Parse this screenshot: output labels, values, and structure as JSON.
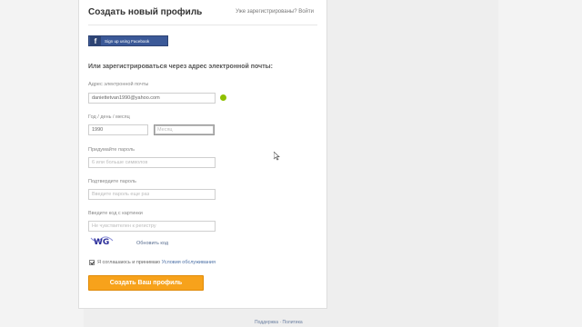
{
  "header": {
    "title": "Создать новый профиль",
    "login_link": "Уже зарегистрированы? Войти"
  },
  "facebook": {
    "label": "Sign up using Facebook",
    "icon": "facebook-f-icon"
  },
  "form": {
    "section_title": "Или зарегистрироваться через адрес электронной почты:",
    "email": {
      "label": "Адрес электронной почты",
      "value": "daniettetvan1990@yahoo.com",
      "status_icon": "check-ok-icon"
    },
    "birthdate": {
      "label": "Год / день / месяц",
      "year_value": "1990",
      "month_placeholder": "Месяц"
    },
    "password": {
      "label": "Придумайте пароль",
      "placeholder": "6 или больше символов"
    },
    "password_confirm": {
      "label": "Подтвердите пароль",
      "placeholder": "Введите пароль еще раз"
    },
    "captcha": {
      "label": "Введите код с картинки",
      "placeholder": "Не чувствителен к регистру",
      "image_text": "WG",
      "refresh_link": "Обновить код"
    },
    "agree": {
      "text": "Я соглашаюсь и принимаю",
      "link": "Условия обслуживания"
    },
    "submit_label": "Создать Ваш профиль"
  },
  "footer": {
    "links": "Поддержка · Политика"
  },
  "colors": {
    "facebook": "#3b5998",
    "submit": "#f7a21b",
    "ok": "#8fc000"
  }
}
